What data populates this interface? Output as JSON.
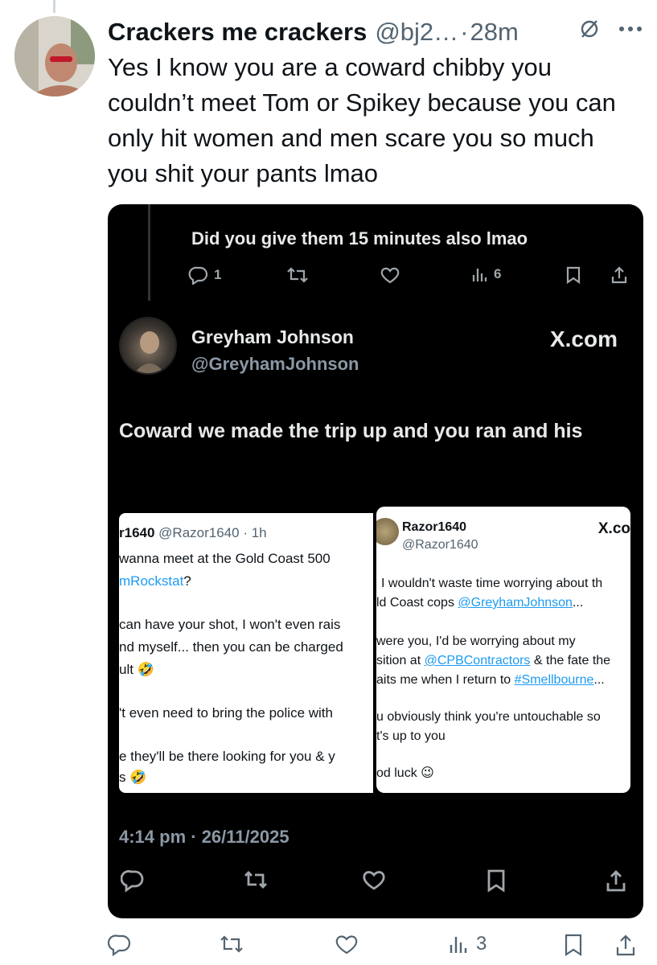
{
  "tweet": {
    "author_name": "Crackers me crackers",
    "author_handle": "@bj2…",
    "separator": "·",
    "time": "28m",
    "text": "Yes I know you are a coward chibby you couldn’t meet Tom or Spikey because you can only hit women and men scare you so much you shit your pants lmao",
    "views": "3"
  },
  "screenshot": {
    "quoted_reply": "Did you give them 15 minutes also lmao",
    "quoted_replies_count": "1",
    "quoted_views": "6",
    "post_name": "Greyham Johnson",
    "post_handle": "@GreyhamJohnson",
    "site_label": "X.com",
    "post_text": "Coward we made the trip up and you ran and his",
    "post_date": "4:14 pm · 26/11/2025",
    "left_card": {
      "header_handle": "r1640",
      "header_meta": "@Razor1640 · 1h",
      "line1": "wanna meet at the Gold Coast 500",
      "line2_link": "mRockstat",
      "line2_rest": "?",
      "line3": "can have your shot, I won't even rais",
      "line4": "nd myself... then you can be charged",
      "line5": "ult 🤣",
      "line6": "'t even need to bring the police with",
      "line7": "e they'll be there looking for you & y",
      "line8": "s 🤣"
    },
    "right_card": {
      "name": "Razor1640",
      "handle": "@Razor1640",
      "site_label": "X.co",
      "line1": "I wouldn't waste time worrying about th",
      "line2_pre": "ld Coast cops ",
      "line2_link": "@GreyhamJohnson",
      "line2_post": "...",
      "line3": "were you, I'd be worrying about my",
      "line4_pre": "sition at ",
      "line4_link": "@CPBContractors",
      "line4_post": " & the fate the",
      "line5_pre": "aits me when I return to ",
      "line5_link": "#Smellbourne",
      "line5_post": "...",
      "line6": "u obviously think you're untouchable so",
      "line7": "t's up to you",
      "line8": "od luck 😉"
    }
  },
  "icons": {
    "more": "more-dots-icon",
    "grok": "grok-icon",
    "reply": "reply-icon",
    "retweet": "retweet-icon",
    "like": "heart-icon",
    "views": "views-icon",
    "bookmark": "bookmark-icon",
    "share": "share-icon"
  }
}
